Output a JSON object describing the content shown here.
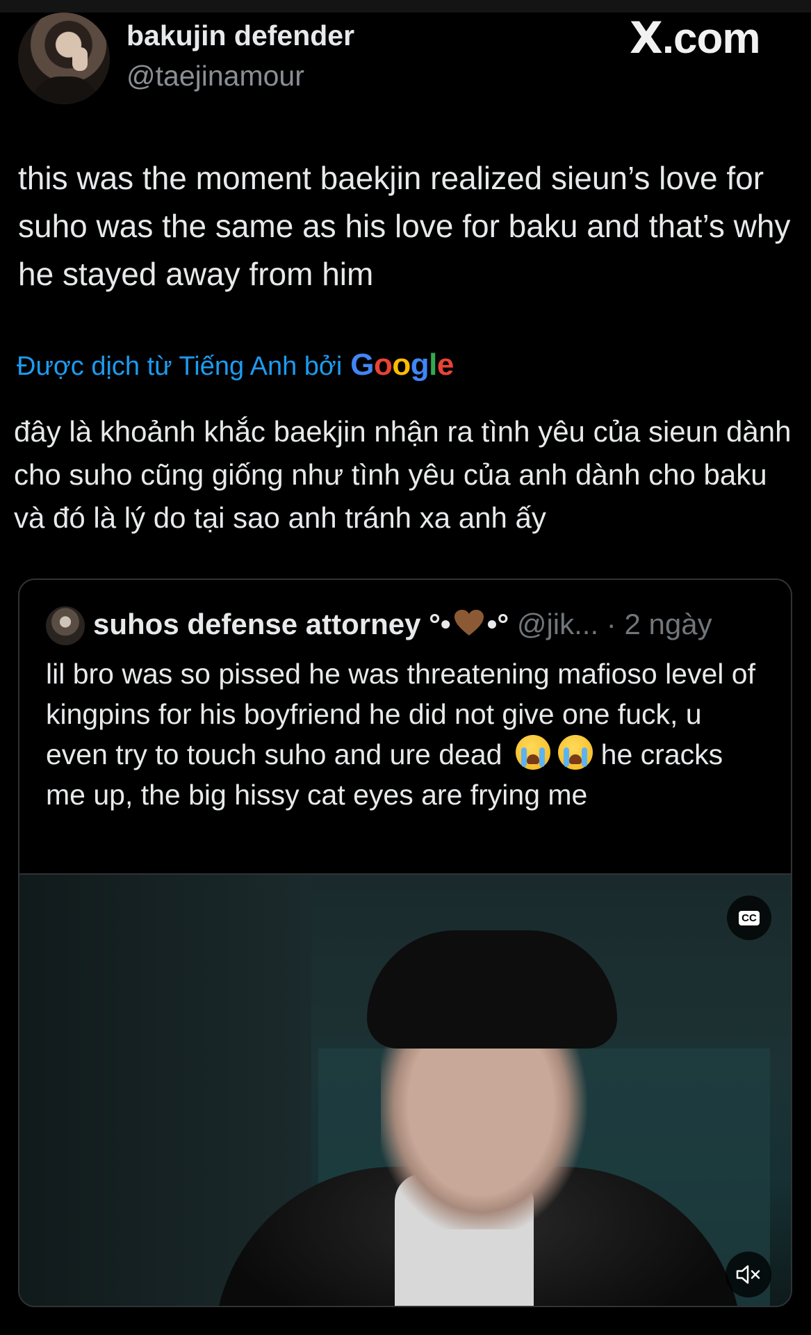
{
  "tweet": {
    "display_name": "bakujin defender",
    "handle": "@taejinamour",
    "text": "this was the moment baekjin realized sieun’s love for suho was the same as his love for baku and that’s why he stayed away from him",
    "translated_by_label": "Được dịch từ Tiếng Anh bởi",
    "translator_brand": "Google",
    "translated_text": "đây là khoảnh khắc baekjin nhận ra tình yêu của sieun dành cho suho cũng giống như tình yêu của anh dành cho baku và đó là lý do tại sao anh tránh xa anh ấy"
  },
  "watermark": {
    "brand": "X",
    "domain": ".com"
  },
  "quoted_tweet": {
    "display_name": "suhos defense attorney",
    "name_decor_left": "°•",
    "name_decor_right": "•°",
    "handle": "@jik...",
    "separator": "·",
    "time": "2 ngày",
    "text_1": "lil bro was so pissed he was threatening mafioso level of kingpins for his boyfriend he did not give one fuck, u even try to touch suho and ure dead",
    "text_2": " he cracks me up, the big hissy cat eyes are frying me",
    "heart_color": "#8b5a34",
    "video": {
      "cc_label": "CC",
      "icons": [
        "closed-captions-icon",
        "speaker-muted-icon"
      ]
    }
  },
  "colors": {
    "background": "#000000",
    "text": "#e7e9ea",
    "secondary_text": "#71767b",
    "link_blue": "#1d9bf0",
    "border": "#2f3336"
  }
}
